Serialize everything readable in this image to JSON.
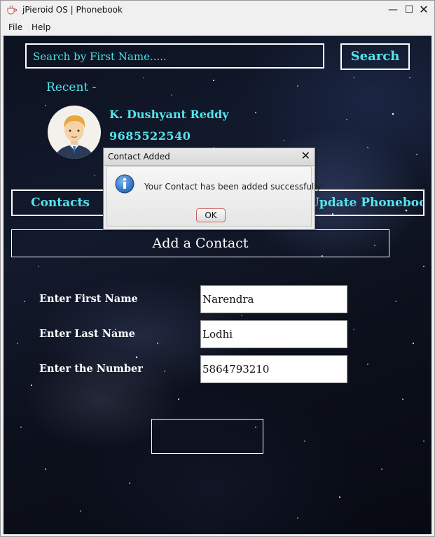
{
  "window": {
    "title": "jPieroid OS | Phonebook"
  },
  "menu": {
    "file": "File",
    "help": "Help"
  },
  "search": {
    "placeholder": "Search by First Name.....",
    "button": "Search"
  },
  "recent": {
    "label": "Recent -",
    "contact_name": "K. Dushyant Reddy",
    "contact_number": "9685522540"
  },
  "nav": {
    "contacts": "Contacts",
    "update": "Update Phonebook"
  },
  "form": {
    "heading": "Add a Contact",
    "first_label": "Enter First Name",
    "last_label": "Enter Last Name",
    "number_label": "Enter the Number",
    "first_value": "Narendra",
    "last_value": "Lodhi",
    "number_value": "5864793210"
  },
  "dialog": {
    "title": "Contact Added",
    "message": "Your Contact has been added successfully",
    "ok": "OK",
    "icon": "info-icon"
  },
  "colors": {
    "accent": "#52e6ee",
    "ok_border": "#d06060"
  }
}
